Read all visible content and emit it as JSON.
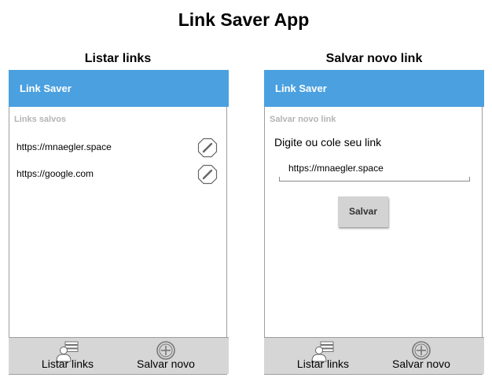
{
  "app_title": "Link Saver App",
  "screens": {
    "list": {
      "title": "Listar links",
      "appbar_title": "Link Saver",
      "section_label": "Links salvos",
      "links": [
        {
          "url": "https://mnaegler.space"
        },
        {
          "url": "https://google.com"
        }
      ]
    },
    "save": {
      "title": "Salvar novo link",
      "appbar_title": "Link Saver",
      "section_label": "Salvar novo link",
      "form_label": "Digite ou cole seu link",
      "input_value": "https://mnaegler.space",
      "button_label": "Salvar"
    }
  },
  "bottom_nav": {
    "list_label": "Listar links",
    "list_icon": "list-user-icon",
    "new_label": "Salvar novo",
    "new_icon": "add-circle-icon"
  },
  "colors": {
    "appbar": "#4ba0e0",
    "bottom_nav": "#d6d6d6",
    "section_label": "#b4b4b4",
    "button": "#d3d3d3"
  }
}
